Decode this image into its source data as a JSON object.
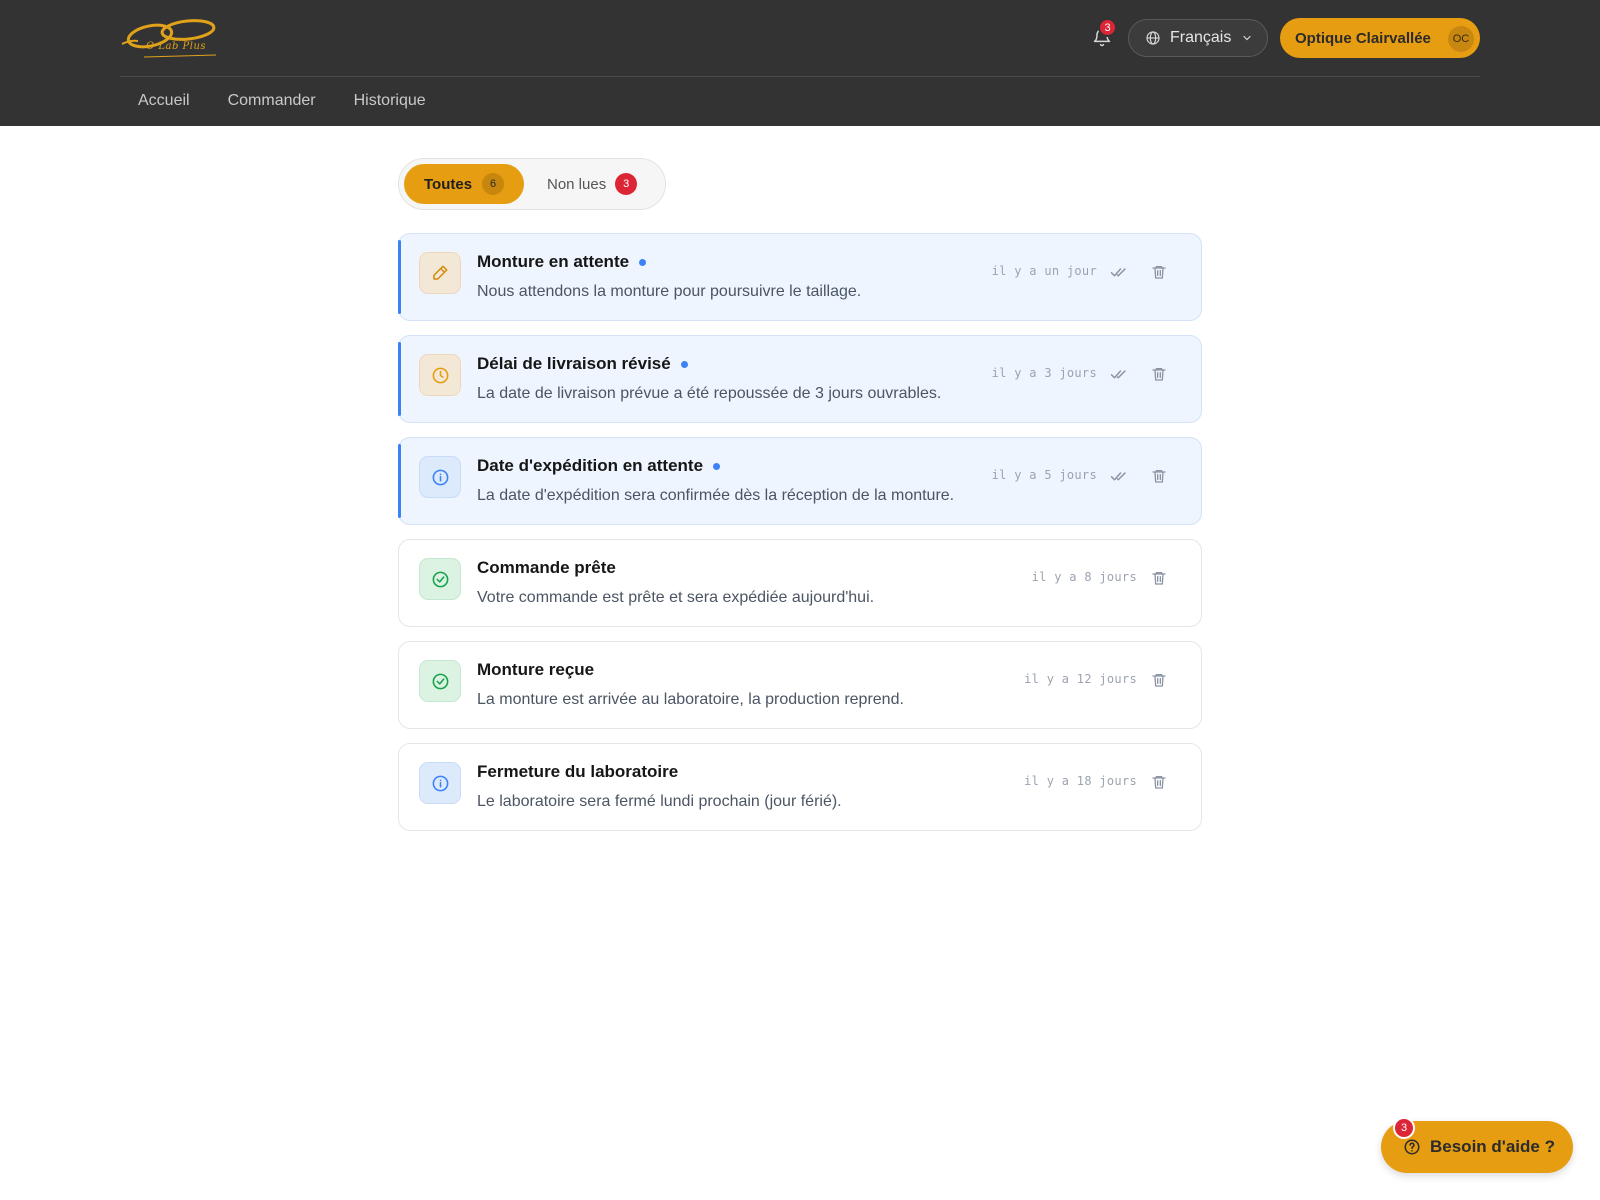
{
  "brand": {
    "logo_text": "O Lab Plus"
  },
  "header": {
    "notification_count": "3",
    "language": "Français",
    "account_name": "Optique Clairvallée",
    "account_initials": "OC"
  },
  "nav": {
    "items": [
      {
        "label": "Accueil"
      },
      {
        "label": "Commander"
      },
      {
        "label": "Historique"
      }
    ]
  },
  "filters": {
    "all": {
      "label": "Toutes",
      "count": "6"
    },
    "unread": {
      "label": "Non lues",
      "count": "3"
    }
  },
  "notifications": [
    {
      "title": "Monture en attente",
      "body": "Nous attendons la monture pour poursuivre le taillage.",
      "time": "il y a un jour",
      "unread": true,
      "icon": "pencil-icon",
      "tone": "amber"
    },
    {
      "title": "Délai de livraison révisé",
      "body": "La date de livraison prévue a été repoussée de 3 jours ouvrables.",
      "time": "il y a 3 jours",
      "unread": true,
      "icon": "clock-icon",
      "tone": "amber"
    },
    {
      "title": "Date d'expédition en attente",
      "body": "La date d'expédition sera confirmée dès la réception de la monture.",
      "time": "il y a 5 jours",
      "unread": true,
      "icon": "info-icon",
      "tone": "blue"
    },
    {
      "title": "Commande prête",
      "body": "Votre commande est prête et sera expédiée aujourd'hui.",
      "time": "il y a 8 jours",
      "unread": false,
      "icon": "check-circle-icon",
      "tone": "green"
    },
    {
      "title": "Monture reçue",
      "body": "La monture est arrivée au laboratoire, la production reprend.",
      "time": "il y a 12 jours",
      "unread": false,
      "icon": "check-circle-icon",
      "tone": "green"
    },
    {
      "title": "Fermeture du laboratoire",
      "body": "Le laboratoire sera fermé lundi prochain (jour férié).",
      "time": "il y a 18 jours",
      "unread": false,
      "icon": "info-icon",
      "tone": "blue"
    }
  ],
  "help": {
    "label": "Besoin d'aide ?",
    "badge": "3"
  },
  "colors": {
    "header_bg": "#333333",
    "accent": "#e69d12",
    "badge_red": "#dc2638",
    "unread_bg": "#eef5ff",
    "unread_marker": "#3b82f6"
  }
}
